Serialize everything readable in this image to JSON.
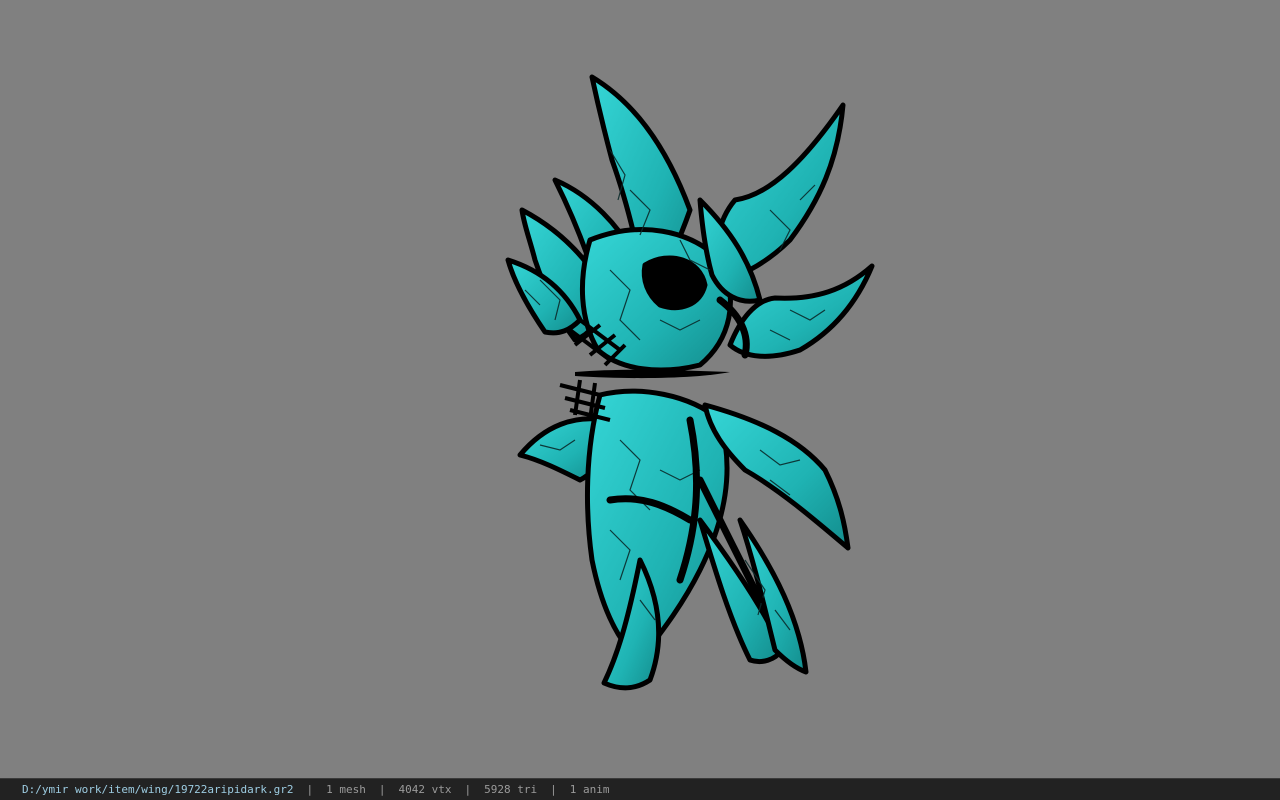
{
  "viewport": {
    "background": "#808080",
    "model": {
      "description_icon": "wing-mesh",
      "fill_color": "#1fbdbd",
      "outline_color": "#000000"
    }
  },
  "status": {
    "file_path": "D:/ymir work/item/wing/19722aripidark.gr2",
    "separator": "|",
    "meshes": "1 mesh",
    "vertices": "4042 vtx",
    "triangles": "5928 tri",
    "animations": "1 anim"
  }
}
